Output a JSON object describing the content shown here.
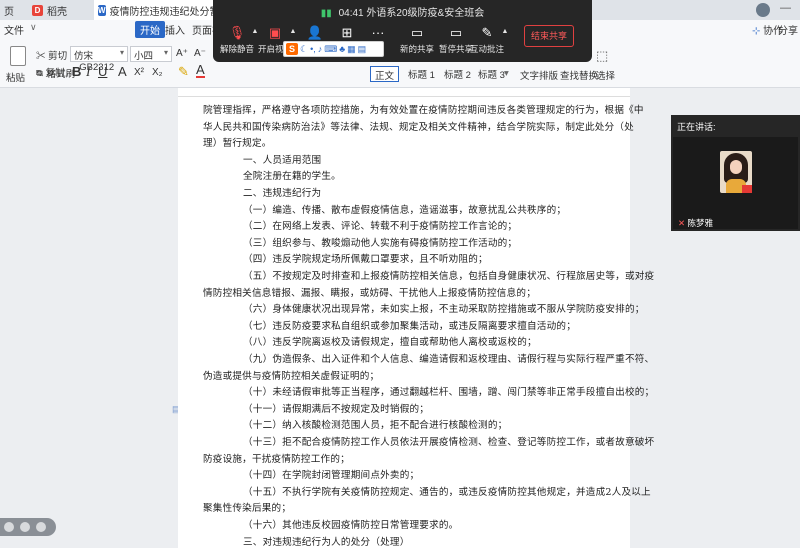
{
  "tabs": [
    {
      "label": "页"
    },
    {
      "label": "稻壳"
    },
    {
      "label": "疫情防控违规违纪处分暂行规律通书"
    }
  ],
  "menu": {
    "file": "文件",
    "start": "开始",
    "insert": "插入",
    "layout": "页面布局"
  },
  "right_menu": {
    "collab": "协作",
    "share": "分享"
  },
  "ribbon": {
    "cut": "剪切",
    "copy": "复制",
    "format_painter": "格式刷",
    "paste": "粘贴",
    "font_name": "仿宋_GB2312",
    "font_size": "小四",
    "styles": [
      "正文",
      "标题 1",
      "标题 2",
      "标题 3"
    ],
    "text_layout": "文字排版",
    "find_replace": "查找替换",
    "select": "选择"
  },
  "meeting": {
    "title": "04:41 外语系20级防疫&安全班会",
    "buttons": [
      "解除静音",
      "开启视频",
      "",
      "",
      "...",
      "",
      "新的共享",
      "暂停共享",
      "互动批注"
    ],
    "end": "结束共享"
  },
  "speaker_panel": {
    "header": "正在讲话:",
    "name": "陈梦雅"
  },
  "document": {
    "lines": [
      {
        "text": "院管理指挥，严格遵守各项防控措施，为有效处置在疫情防控期间违反各类管理规定的行为，根据《中",
        "indent": 0
      },
      {
        "text": "华人民共和国传染病防治法》等法律、法规、规定及相关文件精神，结合学院实际，制定此处分（处",
        "indent": 0
      },
      {
        "text": "理）暂行规定。",
        "indent": 0
      },
      {
        "text": "一、人员适用范围",
        "indent": 2
      },
      {
        "text": "全院注册在籍的学生。",
        "indent": 2
      },
      {
        "text": "二、违规违纪行为",
        "indent": 2
      },
      {
        "text": "（一）编造、传播、散布虚假疫情信息，造谣滋事，故意扰乱公共秩序的；",
        "indent": 2
      },
      {
        "text": "（二）在网络上发表、评论、转载不利于疫情防控工作言论的；",
        "indent": 2
      },
      {
        "text": "（三）组织参与、教唆煽动他人实施有碍疫情防控工作活动的；",
        "indent": 2
      },
      {
        "text": "（四）违反学院规定场所佩戴口罩要求，且不听劝阻的；",
        "indent": 2
      },
      {
        "text": "（五）不按规定及时排查和上报疫情防控相关信息，包括自身健康状况、行程旅居史等，或对疫",
        "indent": 2
      },
      {
        "text": "情防控相关信息错报、漏报、瞒报，或妨碍、干扰他人上报疫情防控信息的；",
        "indent": 0
      },
      {
        "text": "（六）身体健康状况出现异常，未如实上报，不主动采取防控措施或不服从学院防疫安排的；",
        "indent": 2
      },
      {
        "text": "（七）违反防疫要求私自组织或参加聚集活动，或违反隔离要求擅自活动的；",
        "indent": 2
      },
      {
        "text": "（八）违反学院离返校及请假规定，擅自或帮助他人离校或返校的；",
        "indent": 2
      },
      {
        "text": "（九）伪造假条、出入证件和个人信息、编造请假和返校理由、请假行程与实际行程严重不符、",
        "indent": 2
      },
      {
        "text": "伪造或提供与疫情防控相关虚假证明的；",
        "indent": 0
      },
      {
        "text": "（十）未经请假审批等正当程序，通过翻越栏杆、围墙，蹭、闯门禁等非正常手段擅自出校的；",
        "indent": 2
      },
      {
        "text": "（十一）请假期满后不按规定及时销假的；",
        "indent": 2
      },
      {
        "text": "（十二）纳入核酸检测范围人员，拒不配合进行核酸检测的；",
        "indent": 2
      },
      {
        "text": "（十三）拒不配合疫情防控工作人员依法开展疫情检测、检查、登记等防控工作，或者故意破坏",
        "indent": 2
      },
      {
        "text": "防疫设施，干扰疫情防控工作的；",
        "indent": 0
      },
      {
        "text": "（十四）在学院封闭管理期间点外卖的；",
        "indent": 2
      },
      {
        "text": "（十五）不执行学院有关疫情防控规定、通告的，或违反疫情防控其他规定，并造成2人及以上",
        "indent": 2
      },
      {
        "text": "聚集性传染后果的；",
        "indent": 0
      },
      {
        "text": "（十六）其他违反校园疫情防控日常管理要求的。",
        "indent": 2
      },
      {
        "text": "三、对违规违纪行为人的处分（处理）",
        "indent": 2
      }
    ]
  }
}
